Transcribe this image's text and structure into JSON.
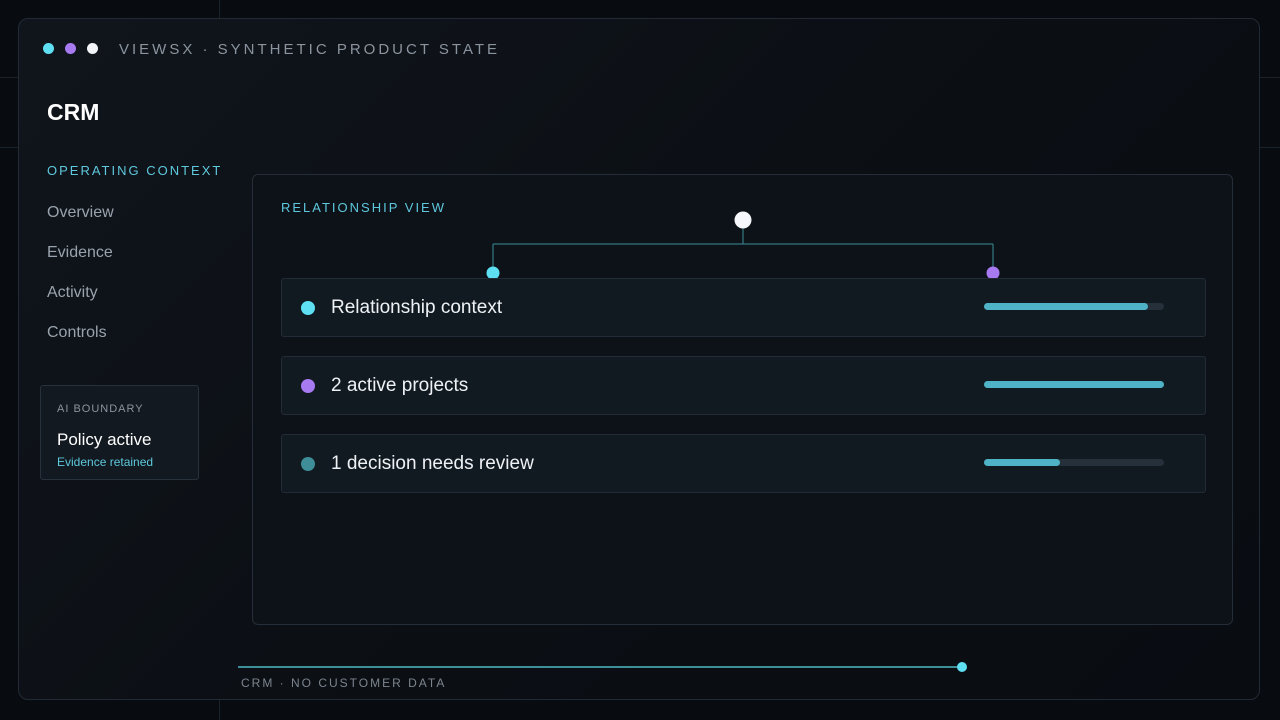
{
  "window": {
    "title": "VIEWSX · SYNTHETIC PRODUCT STATE",
    "dots": [
      "#5ee0f2",
      "#a77af2",
      "#f2f4f7"
    ]
  },
  "app": {
    "title": "CRM"
  },
  "sidebar": {
    "section_label": "OPERATING CONTEXT",
    "items": [
      {
        "label": "Overview"
      },
      {
        "label": "Evidence"
      },
      {
        "label": "Activity"
      },
      {
        "label": "Controls"
      }
    ]
  },
  "boundary": {
    "label": "AI BOUNDARY",
    "status": "Policy active",
    "sub": "Evidence retained"
  },
  "main": {
    "label": "RELATIONSHIP VIEW",
    "rows": [
      {
        "label": "Relationship context",
        "dot_color": "#5ee0f2",
        "progress": 0.91
      },
      {
        "label": "2 active projects",
        "dot_color": "#a77af2",
        "progress": 1.0
      },
      {
        "label": "1 decision needs review",
        "dot_color": "#3f8d98",
        "progress": 0.42
      }
    ]
  },
  "footer": {
    "text": "CRM · NO CUSTOMER DATA",
    "progress": 0.99
  },
  "colors": {
    "accent": "#5ec8dd",
    "purple": "#a77af2",
    "bar": "#4fb3c7"
  }
}
